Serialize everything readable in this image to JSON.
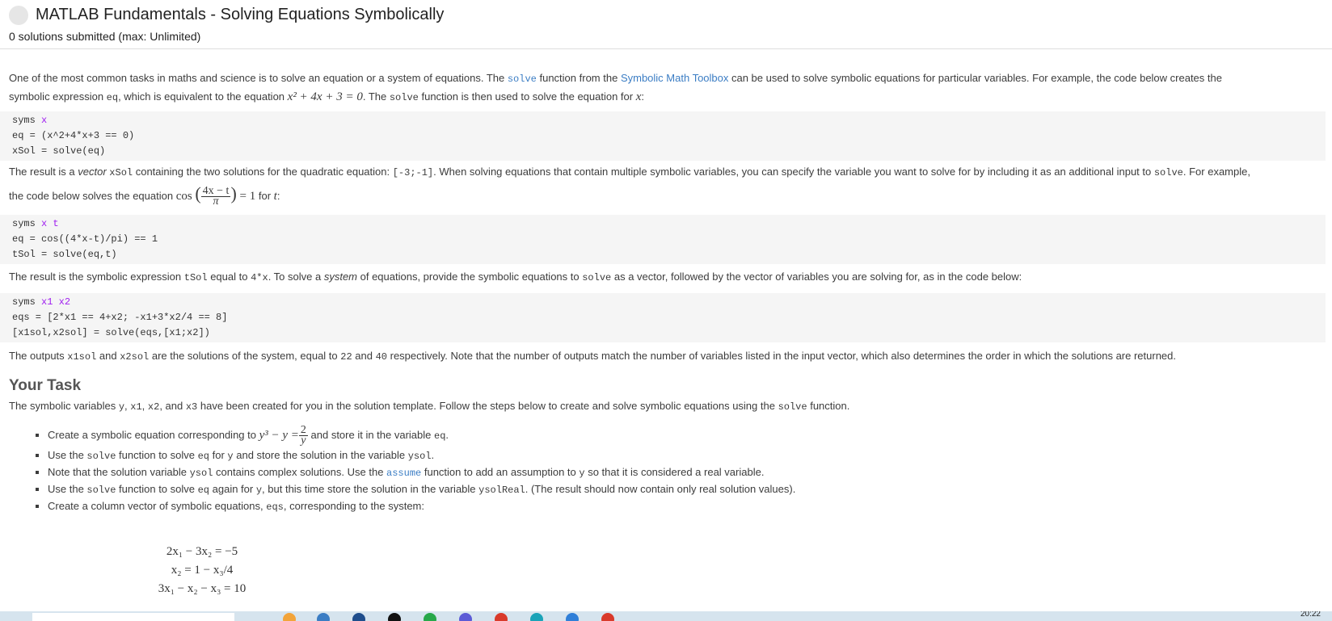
{
  "header": {
    "title": "MATLAB Fundamentals - Solving Equations Symbolically",
    "subtitle": "0 solutions submitted (max: Unlimited)"
  },
  "intro": {
    "p1_a": "One of the most common tasks in maths and science is to solve an equation or a system of equations. The ",
    "p1_solve": "solve",
    "p1_b": " function from the ",
    "p1_toolbox": "Symbolic Math Toolbox",
    "p1_c": " can be used to solve symbolic equations for particular variables. For example, the code below creates the",
    "p2_a": "symbolic expression ",
    "p2_eq": "eq",
    "p2_b": ", which is equivalent to the equation ",
    "p2_math": "x² + 4x + 3 = 0",
    "p2_c": ". The ",
    "p2_solve": "solve",
    "p2_d": " function is then used to solve the equation for ",
    "p2_x": "x",
    "p2_e": ":"
  },
  "code1": {
    "l1a": "syms ",
    "l1b": "x",
    "l2": "eq = (x^2+4*x+3 == 0)",
    "l3": "xSol = solve(eq)"
  },
  "result1": {
    "a": "The result is a ",
    "b": "vector",
    "c": " ",
    "d": "xSol",
    "e": " containing the two solutions for the quadratic equation: ",
    "f": "[-3;-1]",
    "g": ". When solving equations that contain multiple symbolic variables, you can specify the variable you want to solve for by including it as an additional input to ",
    "h": "solve",
    "i": ". For example,",
    "j": "the code below solves the equation ",
    "k": "cos",
    "num": "4x − t",
    "den": "π",
    "l": " = 1",
    "m": " for ",
    "n": "t",
    "o": ":"
  },
  "code2": {
    "l1a": "syms ",
    "l1b": "x t",
    "l2": "eq = cos((4*x-t)/pi) == 1",
    "l3": "tSol = solve(eq,t)"
  },
  "result2": {
    "a": "The result is the symbolic expression ",
    "b": "tSol",
    "c": " equal to ",
    "d": "4*x",
    "e": ". To solve a ",
    "f": "system",
    "g": " of equations, provide the symbolic equations to ",
    "h": "solve",
    "i": " as a vector, followed by the vector of variables you are solving for, as in the code below:"
  },
  "code3": {
    "l1a": "syms ",
    "l1b": "x1 x2",
    "l2": "eqs = [2*x1 == 4+x2; -x1+3*x2/4 == 8]",
    "l3": "[x1sol,x2sol] = solve(eqs,[x1;x2])"
  },
  "result3": {
    "a": "The outputs ",
    "b": "x1sol",
    "c": " and ",
    "d": "x2sol",
    "e": " are the solutions of the system, equal to ",
    "f": "22",
    "g": " and ",
    "h": "40",
    "i": " respectively. Note that the number of outputs match the number of variables listed in the input vector, which also determines the order in which the solutions are returned."
  },
  "task": {
    "title": "Your Task",
    "intro_a": "The symbolic variables ",
    "intro_y": "y",
    "intro_b": ", ",
    "intro_x1": "x1",
    "intro_c": ", ",
    "intro_x2": "x2",
    "intro_d": ", and ",
    "intro_x3": "x3",
    "intro_e": " have been created for you in the solution template. Follow the steps below to create and solve symbolic equations using the ",
    "intro_solve": "solve",
    "intro_f": " function.",
    "items": {
      "i1_a": "Create a symbolic equation corresponding to ",
      "i1_math": "y³ − y =",
      "i1_num": "2",
      "i1_den": "y",
      "i1_b": " and store it in the variable ",
      "i1_c": "eq",
      "i1_d": ".",
      "i2_a": "Use the ",
      "i2_b": "solve",
      "i2_c": " function to solve ",
      "i2_d": "eq",
      "i2_e": " for ",
      "i2_f": "y",
      "i2_g": " and store the solution in the variable ",
      "i2_h": "ysol",
      "i2_i": ".",
      "i3_a": "Note that the solution variable ",
      "i3_b": "ysol",
      "i3_c": " contains complex solutions. Use the ",
      "i3_d": "assume",
      "i3_e": " function to add an assumption to ",
      "i3_f": "y",
      "i3_g": " so that it is considered a real variable.",
      "i4_a": "Use the ",
      "i4_b": "solve",
      "i4_c": " function to solve ",
      "i4_d": "eq",
      "i4_e": " again for ",
      "i4_f": "y",
      "i4_g": ", but this time store the solution in the variable ",
      "i4_h": "ysolReal",
      "i4_i": ". (The result should now contain only real solution values).",
      "i5_a": "Create a column vector of symbolic equations, ",
      "i5_b": "eqs",
      "i5_c": ", corresponding to the system:"
    },
    "system": {
      "e1": "2x₁ − 3x₂ = −5",
      "e2": "x₂ = 1 − x₃/4",
      "e3": "3x₁ − x₂ − x₃ = 10"
    }
  },
  "taskbar": {
    "clock": "20:22"
  }
}
